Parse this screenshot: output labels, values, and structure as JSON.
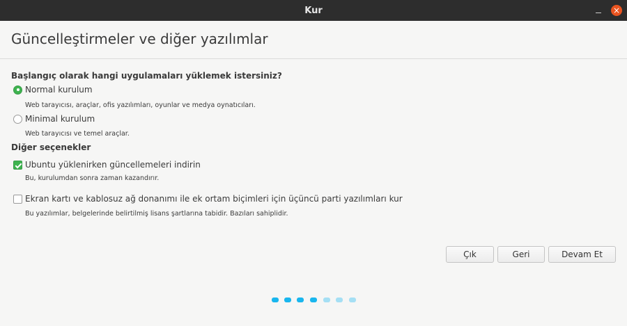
{
  "window": {
    "title": "Kur"
  },
  "page": {
    "title": "Güncelleştirmeler ve diğer yazılımlar"
  },
  "install_type": {
    "question": "Başlangıç olarak hangi uygulamaları yüklemek istersiniz?",
    "normal": {
      "label": "Normal kurulum",
      "description": "Web tarayıcısı, araçlar, ofis yazılımları, oyunlar ve medya oynatıcıları.",
      "selected": true
    },
    "minimal": {
      "label": "Minimal kurulum",
      "description": "Web tarayıcısı ve temel araçlar.",
      "selected": false
    }
  },
  "other_options": {
    "title": "Diğer seçenekler",
    "updates": {
      "label": "Ubuntu yüklenirken güncellemeleri indirin",
      "description": "Bu, kurulumdan sonra zaman kazandırır.",
      "checked": true
    },
    "third_party": {
      "label": "Ekran kartı ve kablosuz ağ donanımı ile ek ortam biçimleri için üçüncü parti yazılımları kur",
      "description": "Bu yazılımlar, belgelerinde belirtilmiş lisans şartlarına tabidir. Bazıları sahiplidir.",
      "checked": false
    }
  },
  "buttons": {
    "quit": "Çık",
    "back": "Geri",
    "continue": "Devam Et"
  },
  "progress": {
    "current_step": 4,
    "total_steps": 7
  },
  "colors": {
    "accent": "#e95420",
    "check": "#3eb34f",
    "dot_active": "#19b6ee",
    "dot_inactive": "#a5dff4"
  }
}
